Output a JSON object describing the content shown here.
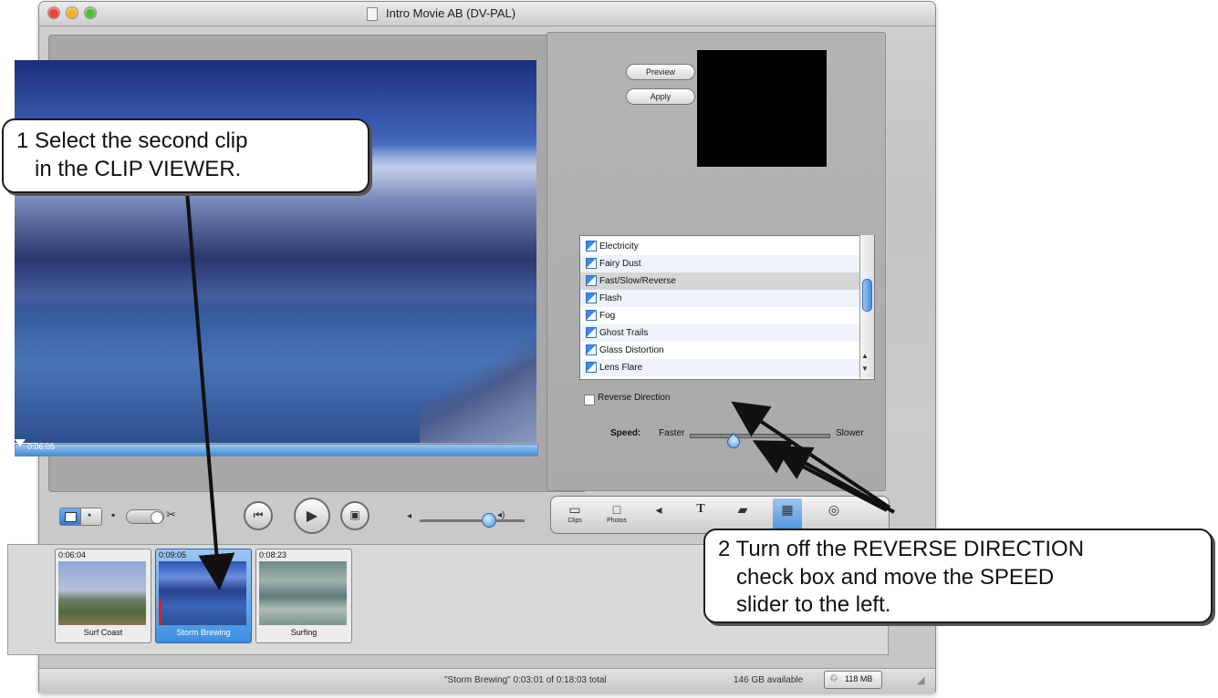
{
  "window": {
    "title": "Intro Movie AB (DV-PAL)",
    "traffic_lights": [
      "close",
      "minimize",
      "zoom"
    ]
  },
  "viewer": {
    "timecode": "0:06:05"
  },
  "effects_panel": {
    "preview_label": "Preview",
    "apply_label": "Apply",
    "effects": [
      "Electricity",
      "Fairy Dust",
      "Fast/Slow/Reverse",
      "Flash",
      "Fog",
      "Ghost Trails",
      "Glass Distortion",
      "Lens Flare"
    ],
    "selected_effect": "Fast/Slow/Reverse",
    "reverse_direction_label": "Reverse Direction",
    "speed_label": "Speed:",
    "faster_label": "Faster",
    "slower_label": "Slower"
  },
  "pane_tabs": [
    {
      "label": "Clips",
      "icon": "clips-icon"
    },
    {
      "label": "Photos",
      "icon": "photos-icon"
    },
    {
      "label": "Audio",
      "icon": "audio-icon"
    },
    {
      "label": "Titles",
      "icon": "titles-icon"
    },
    {
      "label": "Transitions",
      "icon": "transitions-icon"
    },
    {
      "label": "Effects",
      "icon": "effects-icon"
    },
    {
      "label": "iDVD",
      "icon": "idvd-icon"
    }
  ],
  "clips": [
    {
      "time": "0:06:04",
      "name": "Surf Coast"
    },
    {
      "time": "0:09:05",
      "name": "Storm Brewing"
    },
    {
      "time": "0:08:23",
      "name": "Surfing"
    }
  ],
  "status": {
    "summary": "\"Storm Brewing\"  0:03:01 of 0:18:03 total",
    "available": "146 GB available",
    "trash": "118 MB"
  },
  "callouts": {
    "one_line1": "1 Select the second clip",
    "one_line2": "in the CLIP VIEWER.",
    "two_line1": "2 Turn off the REVERSE DIRECTION",
    "two_line2": "check box and move the SPEED",
    "two_line3": "slider to the left."
  },
  "colors": {
    "accent_blue": "#3f8fe0",
    "callout_border": "#1d1d1d"
  }
}
